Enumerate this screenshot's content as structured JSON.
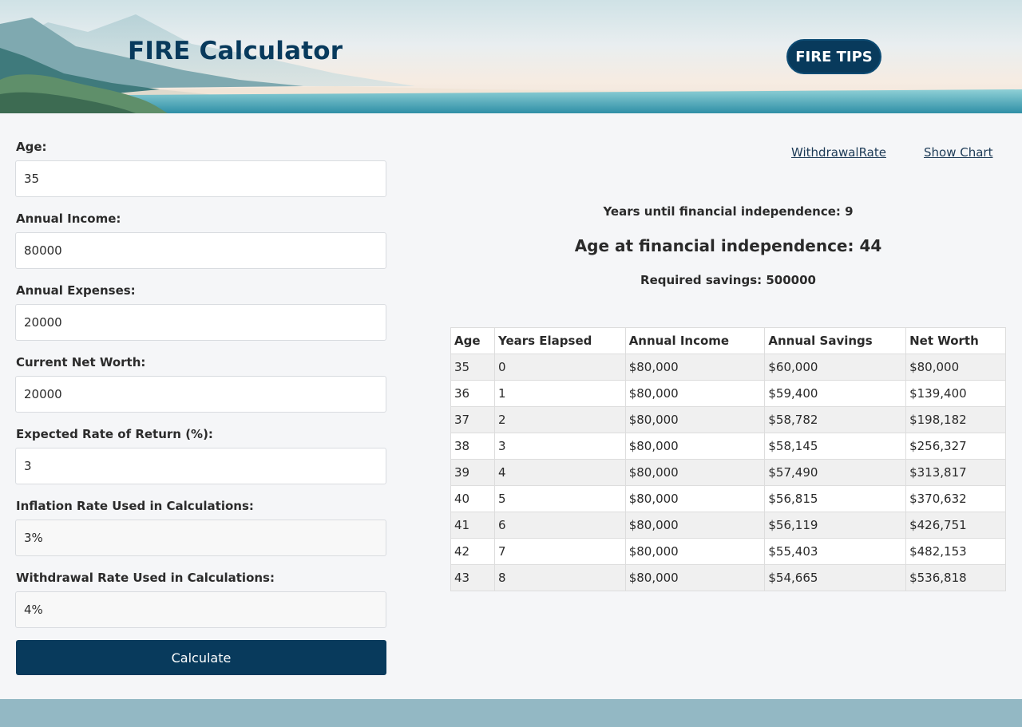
{
  "header": {
    "title": "FIRE Calculator",
    "tips_button": "FIRE TIPS"
  },
  "form": {
    "fields": [
      {
        "label": "Age:",
        "value": "35"
      },
      {
        "label": "Annual Income:",
        "value": "80000"
      },
      {
        "label": "Annual Expenses:",
        "value": "20000"
      },
      {
        "label": "Current Net Worth:",
        "value": "20000"
      },
      {
        "label": "Expected Rate of Return (%):",
        "value": "3"
      },
      {
        "label": "Inflation Rate Used in Calculations:",
        "value": "3%"
      },
      {
        "label": "Withdrawal Rate Used in Calculations:",
        "value": "4%"
      }
    ],
    "calculate_button": "Calculate"
  },
  "links": {
    "withdrawal_rate": "WithdrawalRate",
    "show_chart": "Show Chart"
  },
  "summary": {
    "years_until": "Years until financial independence: 9",
    "age_at": "Age at financial independence: 44",
    "required_savings": "Required savings: 500000"
  },
  "table": {
    "headers": [
      "Age",
      "Years Elapsed",
      "Annual Income",
      "Annual Savings",
      "Net Worth"
    ],
    "rows": [
      [
        "35",
        "0",
        "$80,000",
        "$60,000",
        "$80,000"
      ],
      [
        "36",
        "1",
        "$80,000",
        "$59,400",
        "$139,400"
      ],
      [
        "37",
        "2",
        "$80,000",
        "$58,782",
        "$198,182"
      ],
      [
        "38",
        "3",
        "$80,000",
        "$58,145",
        "$256,327"
      ],
      [
        "39",
        "4",
        "$80,000",
        "$57,490",
        "$313,817"
      ],
      [
        "40",
        "5",
        "$80,000",
        "$56,815",
        "$370,632"
      ],
      [
        "41",
        "6",
        "$80,000",
        "$56,119",
        "$426,751"
      ],
      [
        "42",
        "7",
        "$80,000",
        "$55,403",
        "$482,153"
      ],
      [
        "43",
        "8",
        "$80,000",
        "$54,665",
        "$536,818"
      ]
    ]
  },
  "colors": {
    "primary": "#083a5c",
    "background": "#f5f6f8",
    "footer": "#93b8c4",
    "row_stripe": "#f0f0f0"
  }
}
